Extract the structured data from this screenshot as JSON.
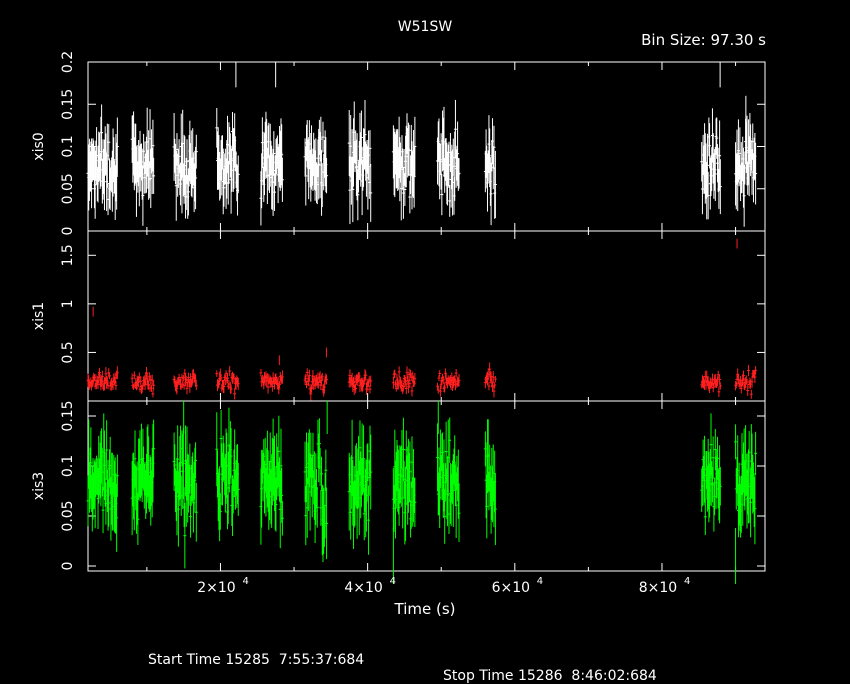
{
  "title": "W51SW",
  "bin_size_label": "Bin Size: 97.30 s",
  "footer": {
    "start": "Start Time 15285  7:55:37:684",
    "stop": "Stop Time 15286  8:46:02:684"
  },
  "colors": {
    "xis0": "#ffffff",
    "xis1": "#ff2020",
    "xis3": "#00ff00",
    "axes": "#ffffff",
    "background": "#000000"
  },
  "chart_data": {
    "type": "scatter",
    "xlabel": "Time (s)",
    "xlim": [
      2000,
      94000
    ],
    "x_ticks": [
      {
        "value": 20000,
        "base": "2×10",
        "exp": "4"
      },
      {
        "value": 40000,
        "base": "4×10",
        "exp": "4"
      },
      {
        "value": 60000,
        "base": "6×10",
        "exp": "4"
      },
      {
        "value": 80000,
        "base": "8×10",
        "exp": "4"
      }
    ],
    "segments": [
      [
        2000,
        6000
      ],
      [
        8000,
        11000
      ],
      [
        13700,
        16800
      ],
      [
        19500,
        22500
      ],
      [
        25500,
        28500
      ],
      [
        31500,
        34500
      ],
      [
        37500,
        40500
      ],
      [
        43500,
        46500
      ],
      [
        49500,
        52500
      ],
      [
        56000,
        57400
      ],
      [
        85400,
        88000
      ],
      [
        90000,
        92800
      ]
    ],
    "bin_size": 97.3,
    "panels": [
      {
        "name": "xis0",
        "ylabel": "xis0",
        "ylim": [
          0,
          0.2
        ],
        "yticks": [
          0,
          0.05,
          0.1,
          0.15,
          0.2
        ],
        "ytick_labels": [
          "0",
          "0.05",
          "0.1",
          "0.15",
          "0.2"
        ],
        "mean": 0.08,
        "spread": 0.022,
        "err": 0.03,
        "outliers": [
          [
            22100,
            0.2
          ],
          [
            27500,
            0.2
          ],
          [
            87900,
            0.2
          ],
          [
            91400,
            0.13
          ]
        ]
      },
      {
        "name": "xis1",
        "ylabel": "xis1",
        "ylim": [
          0,
          1.75
        ],
        "yticks": [
          0.5,
          1,
          1.5
        ],
        "ytick_labels": [
          "0.5",
          "1",
          "1.5"
        ],
        "mean": 0.2,
        "spread": 0.06,
        "err": 0.05,
        "outliers": [
          [
            2700,
            0.92
          ],
          [
            90200,
            1.62
          ],
          [
            28000,
            0.42
          ],
          [
            34400,
            0.5
          ]
        ]
      },
      {
        "name": "xis3",
        "ylabel": "xis3",
        "ylim": [
          -0.005,
          0.165
        ],
        "yticks": [
          0,
          0.05,
          0.1,
          0.15
        ],
        "ytick_labels": [
          "0",
          "0.05",
          "0.1",
          "0.15"
        ],
        "mean": 0.085,
        "spread": 0.024,
        "err": 0.028,
        "outliers": [
          [
            15000,
            0.16
          ],
          [
            34500,
            0.16
          ],
          [
            49600,
            0.16
          ],
          [
            90000,
            0.01
          ],
          [
            43500,
            0.01
          ]
        ]
      }
    ]
  }
}
